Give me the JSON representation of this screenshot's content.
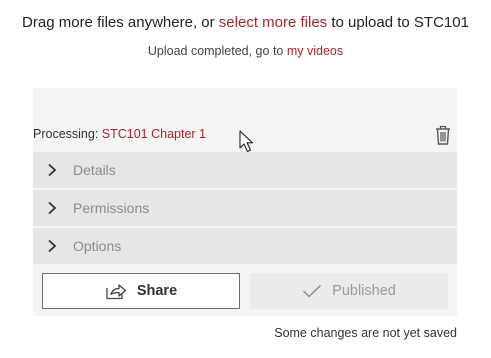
{
  "upload": {
    "prefix": "Drag more files anywhere, or ",
    "select_link": "select more files",
    "suffix": " to upload to STC101",
    "status_prefix": "Upload completed, go to ",
    "videos_link": "my videos"
  },
  "item": {
    "processing_label": "Processing: ",
    "video_name": "STC101 Chapter 1"
  },
  "sections": [
    {
      "label": "Details"
    },
    {
      "label": "Permissions"
    },
    {
      "label": "Options"
    }
  ],
  "actions": {
    "share_label": "Share",
    "published_label": "Published"
  },
  "footer": {
    "unsaved_note": "Some changes are not yet saved"
  },
  "icons": {
    "delete": "trash-icon",
    "expand": "chevron-right-icon",
    "share": "share-icon",
    "published": "checkmark-icon",
    "cursor": "mouse-pointer-icon"
  },
  "colors": {
    "link": "#a4262c",
    "panel": "#f4f4f4",
    "section": "#e6e6e6",
    "disabled_button": "#ebebeb"
  }
}
